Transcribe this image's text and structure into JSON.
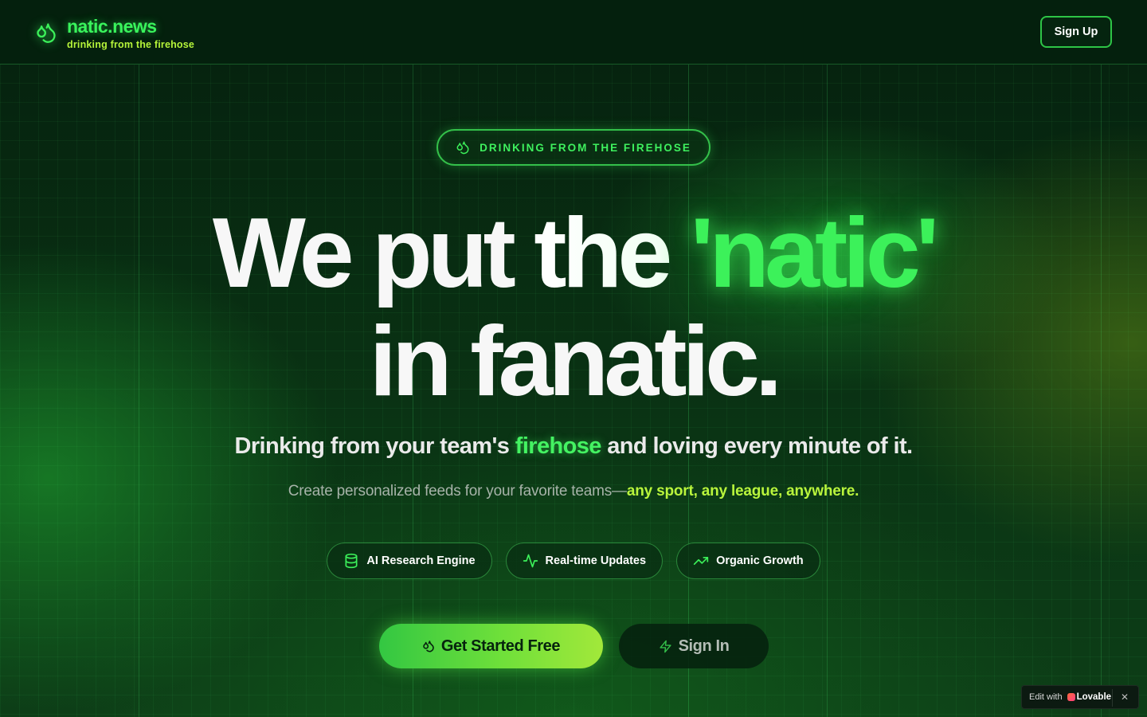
{
  "header": {
    "brand_name": "natic.news",
    "brand_tagline": "drinking from the firehose",
    "signup_label": "Sign Up"
  },
  "hero": {
    "badge_label": "DRINKING FROM THE FIREHOSE",
    "headline_line1_prefix": "We put ",
    "headline_line1_the": "the ",
    "headline_line1_accent": "'natic'",
    "headline_line2": "in fanatic.",
    "subhead_before": "Drinking from your team's ",
    "subhead_highlight": "firehose",
    "subhead_after": " and loving every minute of it.",
    "description_before": "Create personalized feeds for your favorite teams—",
    "description_highlight": "any sport, any league, anywhere."
  },
  "features": [
    {
      "label": "AI Research Engine",
      "icon": "database-icon"
    },
    {
      "label": "Real-time Updates",
      "icon": "activity-icon"
    },
    {
      "label": "Organic Growth",
      "icon": "trending-up-icon"
    }
  ],
  "cta": {
    "primary_label": "Get Started Free",
    "secondary_label": "Sign In"
  },
  "lovable_badge": {
    "edit_text": "Edit with",
    "brand": "Lovable",
    "close_icon": "close-icon"
  },
  "colors": {
    "accent_green": "#3cf15a",
    "lime": "#b9f53c",
    "background": "#06210f"
  }
}
